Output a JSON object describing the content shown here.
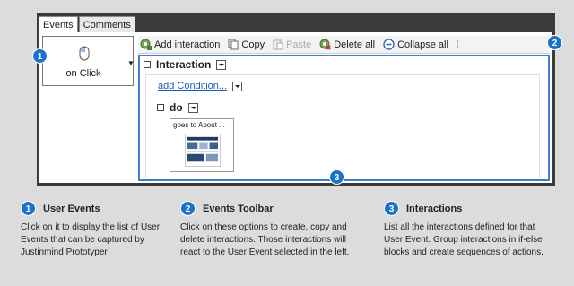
{
  "tabs": [
    "Events",
    "Comments"
  ],
  "event": {
    "label": "on Click"
  },
  "toolbar": {
    "buttons": [
      {
        "label": "Add interaction",
        "icon": "add-interaction-icon"
      },
      {
        "label": "Copy",
        "icon": "copy-icon"
      },
      {
        "label": "Paste",
        "icon": "paste-icon",
        "disabled": true
      },
      {
        "label": "Delete all",
        "icon": "delete-icon"
      },
      {
        "label": "Collapse all",
        "icon": "collapse-icon"
      }
    ]
  },
  "interaction": {
    "header": "Interaction",
    "add_condition": "add Condition...",
    "do_label": "do",
    "action_label": "goes to About ..."
  },
  "badges": [
    "1",
    "2",
    "3"
  ],
  "legend": [
    {
      "number": "1",
      "title": "User Events",
      "text": "Click on it to display the list of User Events that can be captured by Justinmind Prototyper"
    },
    {
      "number": "2",
      "title": "Events Toolbar",
      "text": "Click on these options to create, copy and delete interactions. Those interactions will react to the User Event selected in the left."
    },
    {
      "number": "3",
      "title": "Interactions",
      "text": "List all the interactions defined for that User Event. Group interactions in if-else blocks and create sequences of actions."
    }
  ],
  "colors": {
    "accent": "#1a73c8",
    "frame": "#3b3b3b",
    "highlight": "#3b7fd1"
  }
}
